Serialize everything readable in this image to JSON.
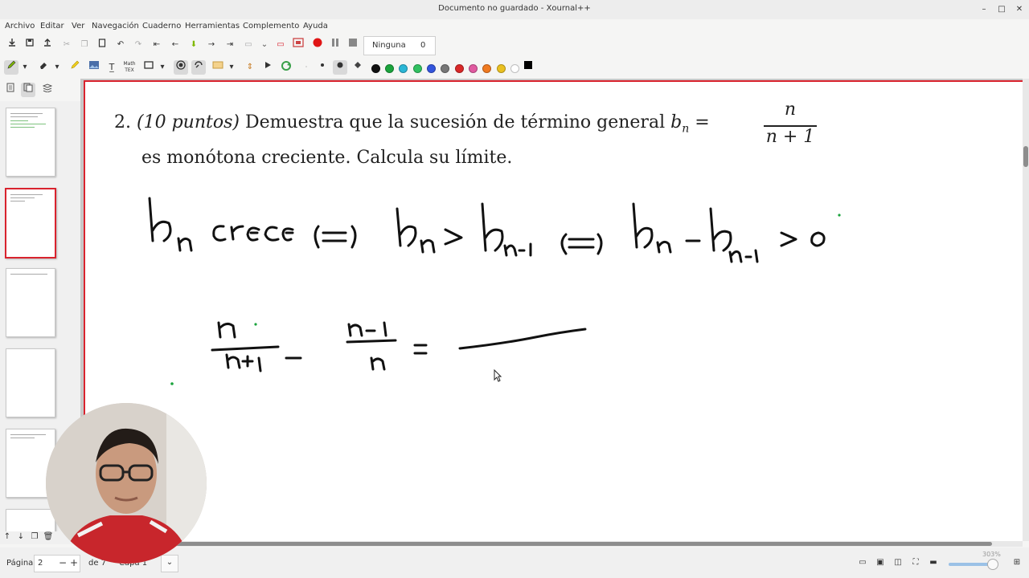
{
  "window": {
    "title": "Documento no guardado - Xournal++",
    "controls": [
      "–",
      "□",
      "✕"
    ]
  },
  "menu": [
    "Archivo",
    "Editar",
    "Ver",
    "Navegación",
    "Cuaderno",
    "Herramientas",
    "Complemento",
    "Ayuda"
  ],
  "toolbar": {
    "layer_name": "Ninguna",
    "layer_count": "0"
  },
  "colors": {
    "accent_red": "#d9232e",
    "palette": [
      "#111111",
      "#1aa33c",
      "#30b030",
      "#2ab6d6",
      "#27a7e0",
      "#3355dd",
      "#777777",
      "#d92828",
      "#e05aa0",
      "#f07a20",
      "#eac020",
      "#ffffff",
      "#000000"
    ]
  },
  "problem": {
    "number": "2.",
    "points": "(10 puntos)",
    "statement": "Demuestra que la sucesión de término general",
    "lhs": "b",
    "lhs_sub": "n",
    "equals": "=",
    "numerator": "n",
    "denominator": "n + 1",
    "statement_line2": "es monótona creciente. Calcula su límite."
  },
  "handwriting": {
    "line1": [
      "b",
      "n",
      "crece",
      "⇔",
      "b",
      "n",
      ">",
      "b",
      "n-1",
      "⇔",
      "b",
      "n",
      "-",
      "b",
      "n-1",
      ">",
      "0"
    ],
    "line2": [
      "n",
      "n+1",
      "-",
      "n-1",
      "n",
      "="
    ]
  },
  "statusbar": {
    "page_label": "Página",
    "page_value": "2",
    "page_total": "de 7",
    "layer_label": "Capa 1",
    "zoom": "303%"
  }
}
